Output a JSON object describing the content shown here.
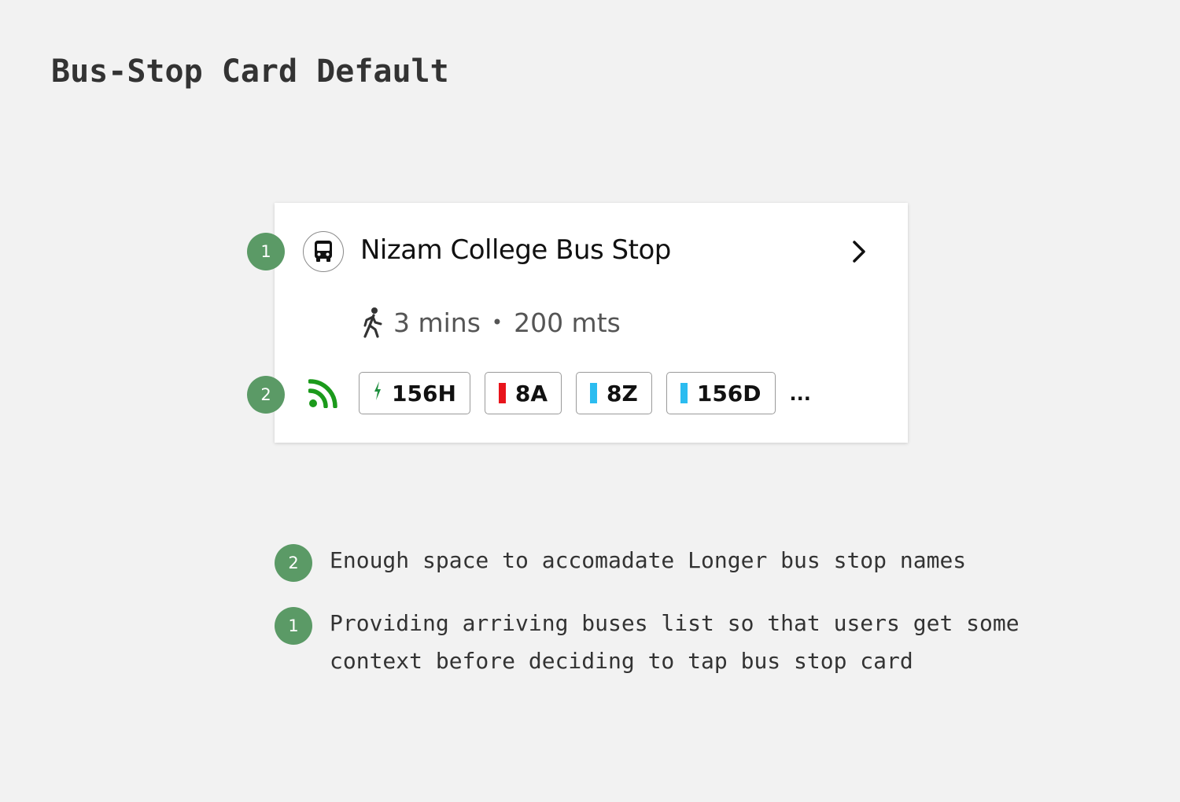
{
  "page": {
    "title": "Bus-Stop Card Default"
  },
  "card": {
    "marker_top": "1",
    "marker_bottom": "2",
    "stop_name": "Nizam College Bus Stop",
    "icons": {
      "stop": "bus-icon",
      "open": "chevron-right-icon",
      "walk": "walking-icon",
      "live": "live-signal-icon"
    },
    "walk_time": "3 mins",
    "separator": "•",
    "distance": "200 mts",
    "routes": [
      {
        "label": "156H",
        "indicator": "bolt",
        "color": "#1e8e3e"
      },
      {
        "label": "8A",
        "indicator": "bar",
        "color": "#e8141b"
      },
      {
        "label": "8Z",
        "indicator": "bar",
        "color": "#2bbcf0"
      },
      {
        "label": "156D",
        "indicator": "bar",
        "color": "#2bbcf0"
      }
    ],
    "more_label": "...",
    "live_color": "#1b9a1b"
  },
  "notes": [
    {
      "marker": "2",
      "text": "Enough space to accomadate Longer bus stop names"
    },
    {
      "marker": "1",
      "text": "Providing arriving buses list so that users get some context before deciding to tap bus stop card"
    }
  ],
  "colors": {
    "marker": "#5b9a66",
    "background": "#f2f2f2",
    "card": "#ffffff"
  }
}
